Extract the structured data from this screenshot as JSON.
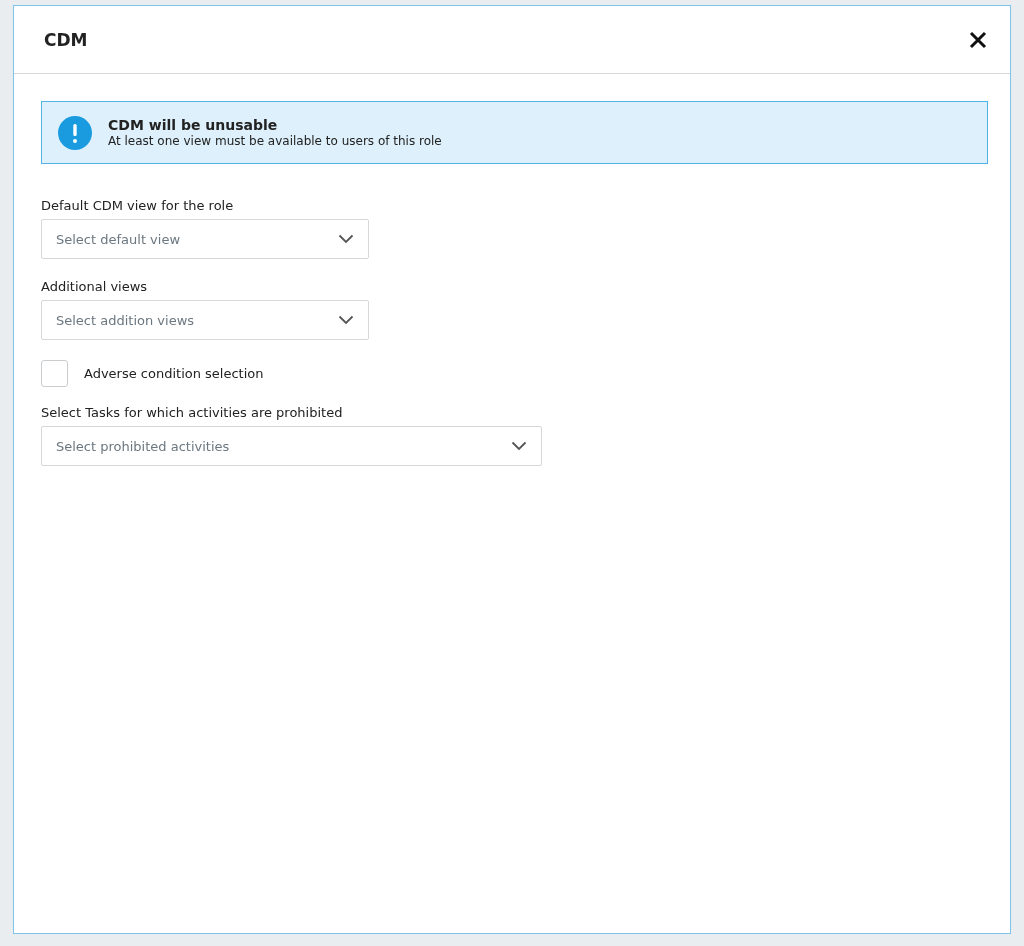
{
  "dialog": {
    "title": "CDM"
  },
  "alert": {
    "title": "CDM will be unusable",
    "message": "At least one view must be available to users of this role"
  },
  "fields": [
    {
      "kind": "select",
      "label": "Default CDM view for the role",
      "placeholder": "Select default view",
      "wide": false
    },
    {
      "kind": "select",
      "label": "Additional views",
      "placeholder": "Select addition views",
      "wide": false
    },
    {
      "kind": "checkbox",
      "label": "Adverse condition selection",
      "checked": false
    },
    {
      "kind": "select",
      "label": "Select Tasks for which activities are prohibited",
      "placeholder": "Select prohibited activities",
      "wide": true
    }
  ]
}
